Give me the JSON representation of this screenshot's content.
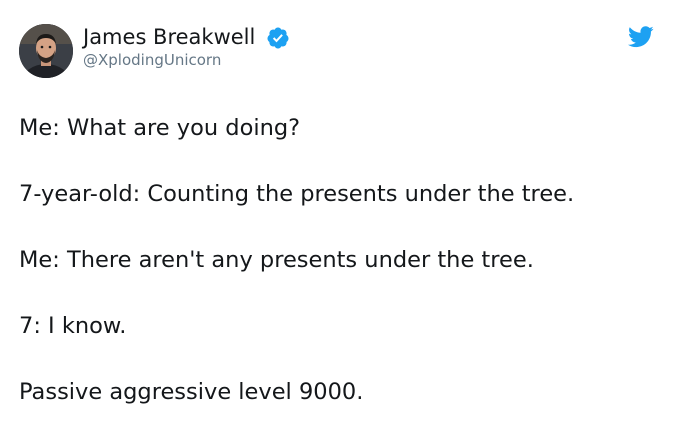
{
  "author": {
    "display_name": "James Breakwell",
    "handle": "@XplodingUnicorn",
    "verified": true,
    "avatar_icon": "profile-photo"
  },
  "brand": {
    "icon": "twitter-bird-icon",
    "accent_color": "#1da1f2"
  },
  "tweet": {
    "lines": [
      "Me: What are you doing?",
      "7-year-old: Counting the presents under the tree.",
      "Me: There aren't any presents under the tree.",
      "7: I know.",
      "Passive aggressive level 9000."
    ]
  }
}
